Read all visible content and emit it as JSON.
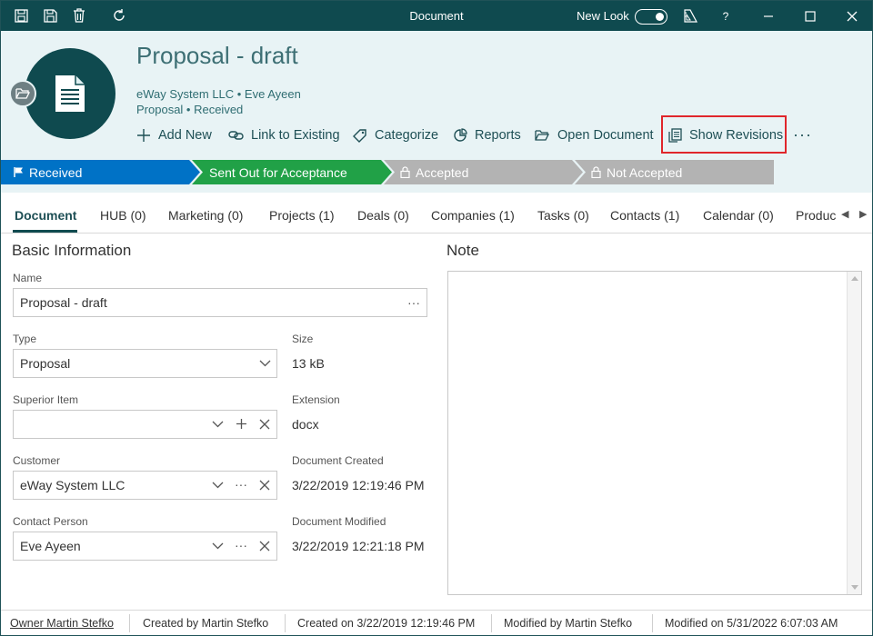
{
  "window": {
    "title": "Document",
    "new_look_label": "New Look",
    "help_label": "?"
  },
  "record": {
    "title": "Proposal - draft",
    "subtitle_line1": "eWay System LLC • Eve Ayeen",
    "subtitle_line2": "Proposal • Received"
  },
  "actions": {
    "add_new": "Add New",
    "link_to_existing": "Link to Existing",
    "categorize": "Categorize",
    "reports": "Reports",
    "open_document": "Open Document",
    "show_revisions": "Show Revisions",
    "more": "···"
  },
  "stages": [
    {
      "label": "Received",
      "color": "#0072c6"
    },
    {
      "label": "Sent Out for Acceptance",
      "color": "#21a147"
    },
    {
      "label": "Accepted",
      "color": "#b3b3b3"
    },
    {
      "label": "Not Accepted",
      "color": "#b3b3b3"
    }
  ],
  "tabs": [
    {
      "label": "Document"
    },
    {
      "label": "HUB (0)"
    },
    {
      "label": "Marketing (0)"
    },
    {
      "label": "Projects (1)"
    },
    {
      "label": "Deals (0)"
    },
    {
      "label": "Companies (1)"
    },
    {
      "label": "Tasks (0)"
    },
    {
      "label": "Contacts (1)"
    },
    {
      "label": "Calendar (0)"
    },
    {
      "label": "Produc"
    }
  ],
  "basic_info": {
    "title": "Basic Information",
    "name_label": "Name",
    "name_value": "Proposal - draft",
    "type_label": "Type",
    "type_value": "Proposal",
    "size_label": "Size",
    "size_value": "13 kB",
    "superior_label": "Superior Item",
    "superior_value": "",
    "extension_label": "Extension",
    "extension_value": "docx",
    "customer_label": "Customer",
    "customer_value": "eWay System LLC",
    "created_label": "Document Created",
    "created_value": "3/22/2019 12:19:46 PM",
    "contact_label": "Contact Person",
    "contact_value": "Eve Ayeen",
    "modified_label": "Document Modified",
    "modified_value": "3/22/2019 12:21:18 PM"
  },
  "note": {
    "title": "Note",
    "value": ""
  },
  "status": {
    "owner": "Owner Martin Stefko",
    "created_by": "Created by Martin Stefko",
    "created_on": "Created on 3/22/2019 12:19:46 PM",
    "modified_by": "Modified by Martin Stefko",
    "modified_on": "Modified on 5/31/2022 6:07:03 AM"
  },
  "colors": {
    "brand": "#0f4a4f",
    "header_bg": "#e8f3f5",
    "highlight": "#e0262b"
  }
}
